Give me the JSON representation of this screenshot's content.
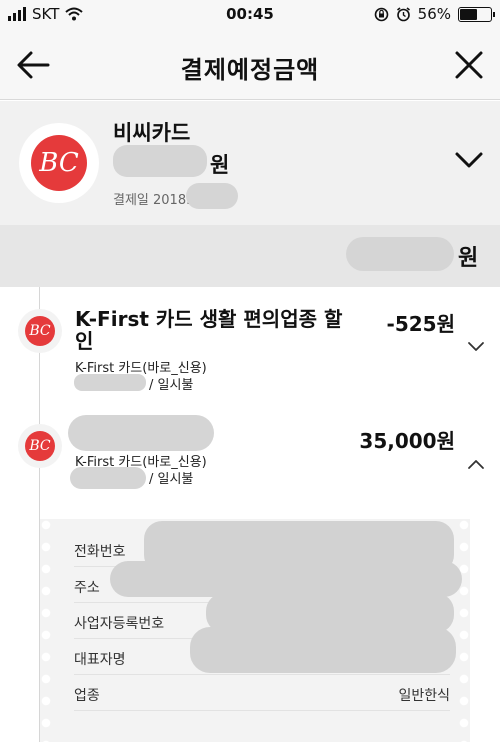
{
  "status_bar": {
    "carrier": "SKT",
    "time": "00:45",
    "battery": "56%",
    "battery_level": 0.56
  },
  "header": {
    "title": "결제예정금액",
    "back_icon": "arrow-left-icon",
    "close_icon": "close-icon"
  },
  "summary": {
    "card_name": "비씨카드",
    "amount_unit": "원",
    "due_date_label": "결제일 2018.",
    "logo_text": "BC"
  },
  "total": {
    "amount_unit": "원"
  },
  "transactions": [
    {
      "title": "K-First 카드 생활 편의업종 할인",
      "amount": "-525원",
      "card": "K-First 카드(바로_신용)",
      "installment": "/ 일시불",
      "expanded": false
    },
    {
      "title": "",
      "amount": "35,000원",
      "card": "K-First 카드(바로_신용)",
      "installment": "/ 일시불",
      "expanded": true
    }
  ],
  "details": [
    {
      "label": "전화번호",
      "value": ""
    },
    {
      "label": "주소",
      "value": ""
    },
    {
      "label": "사업자등록번호",
      "value": ""
    },
    {
      "label": "대표자명",
      "value": ""
    },
    {
      "label": "업종",
      "value": "일반한식"
    }
  ]
}
